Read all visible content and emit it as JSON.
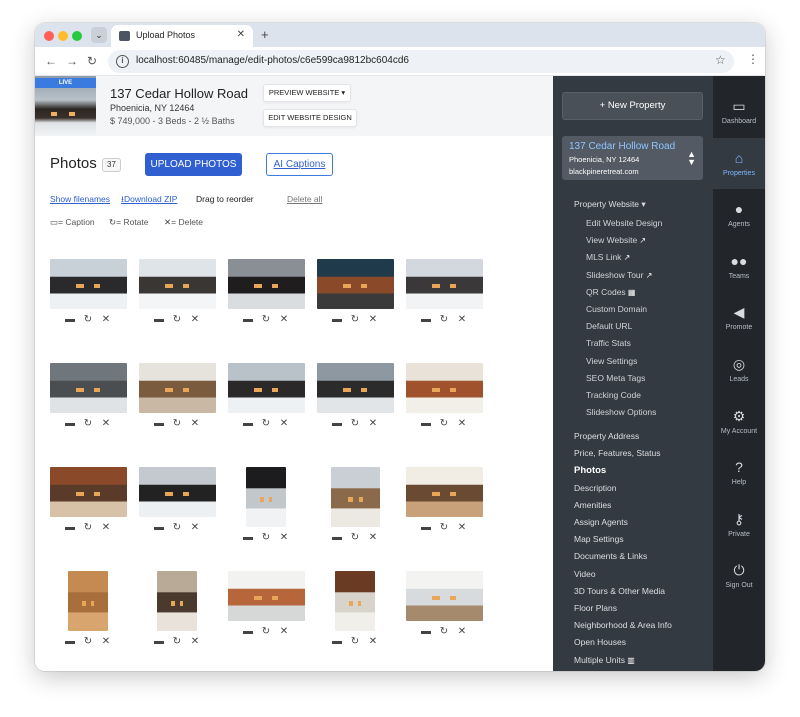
{
  "browser": {
    "tab_title": "Upload Photos",
    "url": "localhost:60485/manage/edit-photos/c6e599ca9812bc604cd6"
  },
  "property": {
    "badge": "LIVE",
    "title": "137 Cedar Hollow Road",
    "city": "Phoenicia, NY 12464",
    "price_line": "$ 749,000 - 3 Beds - 2 ½ Baths",
    "preview_label": "PREVIEW WEBSITE ▾",
    "edit_design_label": "EDIT WEBSITE DESIGN"
  },
  "photos_section": {
    "title": "Photos",
    "count": "37",
    "upload_label": "UPLOAD PHOTOS",
    "ai_label": "AI Captions",
    "show_filenames": "Show filenames",
    "download_zip": "Download ZIP",
    "drag_text": "Drag to reorder",
    "delete_all": "Delete all",
    "legend_caption": "= Caption",
    "legend_rotate": "= Rotate",
    "legend_delete": "= Delete"
  },
  "photos": [
    {
      "colors": [
        "#c8d0d8",
        "#2a2a2c",
        "#eef1f3"
      ]
    },
    {
      "colors": [
        "#dfe4e8",
        "#3a3634",
        "#f3f5f6"
      ]
    },
    {
      "colors": [
        "#8a8f96",
        "#1f1d1e",
        "#d9dde0"
      ]
    },
    {
      "colors": [
        "#1f3a4a",
        "#8a4a2a",
        "#3a3a3a"
      ]
    },
    {
      "colors": [
        "#d2d8dd",
        "#3a3838",
        "#f1f3f4"
      ]
    },
    {
      "colors": [
        "#6f767c",
        "#4a4e50",
        "#dfe3e6"
      ]
    },
    {
      "colors": [
        "#e6e2dc",
        "#7a5b3e",
        "#c9b9a4"
      ]
    },
    {
      "colors": [
        "#b9c1c9",
        "#2a2829",
        "#eef1f3"
      ]
    },
    {
      "colors": [
        "#8e98a1",
        "#2c2b2c",
        "#e1e5e8"
      ]
    },
    {
      "colors": [
        "#e8e2d8",
        "#a0522d",
        "#f2eee8"
      ]
    },
    {
      "colors": [
        "#8a4a2a",
        "#5a3b2a",
        "#d7c2a8"
      ]
    },
    {
      "colors": [
        "#c3c9ce",
        "#232223",
        "#ecf0f2"
      ]
    },
    {
      "colors": [
        "#1c1b1d",
        "#c2c7cc",
        "#f0f2f4"
      ]
    },
    {
      "colors": [
        "#c9cfd4",
        "#8a6a4a",
        "#ece8e2"
      ]
    },
    {
      "colors": [
        "#f1ece4",
        "#6b4a33",
        "#c8a07a"
      ]
    },
    {
      "colors": [
        "#c58a52",
        "#a86e3c",
        "#d9a56f"
      ]
    },
    {
      "colors": [
        "#b9aa98",
        "#4a3a2e",
        "#e8e2da"
      ]
    },
    {
      "colors": [
        "#f2f2f0",
        "#b7653a",
        "#d6d8d8"
      ]
    },
    {
      "colors": [
        "#6a3a22",
        "#d8d4cc",
        "#f1efea"
      ]
    },
    {
      "colors": [
        "#f3f3f2",
        "#d7dbdd",
        "#a58a6d"
      ]
    }
  ],
  "sidebar": {
    "new_property": "New Property",
    "card_title": "137 Cedar Hollow Road",
    "card_city": "Phoenicia, NY 12464",
    "card_domain": "blackpineretreat.com",
    "property_website": "Property Website ▾",
    "sub_items": [
      {
        "label": "Edit Website Design",
        "ext": ""
      },
      {
        "label": "View Website",
        "ext": "↗"
      },
      {
        "label": "MLS Link",
        "ext": "↗"
      },
      {
        "label": "Slideshow Tour",
        "ext": "↗"
      },
      {
        "label": "QR Codes",
        "ext": "▦"
      },
      {
        "label": "Custom Domain",
        "ext": ""
      },
      {
        "label": "Default URL",
        "ext": ""
      },
      {
        "label": "Traffic Stats",
        "ext": ""
      },
      {
        "label": "View Settings",
        "ext": ""
      },
      {
        "label": "SEO Meta Tags",
        "ext": ""
      },
      {
        "label": "Tracking Code",
        "ext": ""
      },
      {
        "label": "Slideshow Options",
        "ext": ""
      }
    ],
    "items": [
      {
        "label": "Property Address",
        "active": false,
        "ext": ""
      },
      {
        "label": "Price, Features, Status",
        "active": false,
        "ext": ""
      },
      {
        "label": "Photos",
        "active": true,
        "ext": ""
      },
      {
        "label": "Description",
        "active": false,
        "ext": ""
      },
      {
        "label": "Amenities",
        "active": false,
        "ext": ""
      },
      {
        "label": "Assign Agents",
        "active": false,
        "ext": ""
      },
      {
        "label": "Map Settings",
        "active": false,
        "ext": ""
      },
      {
        "label": "Documents & Links",
        "active": false,
        "ext": ""
      },
      {
        "label": "Video",
        "active": false,
        "ext": ""
      },
      {
        "label": "3D Tours & Other Media",
        "active": false,
        "ext": ""
      },
      {
        "label": "Floor Plans",
        "active": false,
        "ext": ""
      },
      {
        "label": "Neighborhood & Area Info",
        "active": false,
        "ext": ""
      },
      {
        "label": "Open Houses",
        "active": false,
        "ext": ""
      },
      {
        "label": "Multiple Units",
        "active": false,
        "ext": "▥"
      }
    ]
  },
  "rail": [
    {
      "label": "Dashboard",
      "icon": "dashboard-icon",
      "glyph": "▭",
      "active": false
    },
    {
      "label": "Properties",
      "icon": "properties-icon",
      "glyph": "⌂",
      "active": true
    },
    {
      "label": "Agents",
      "icon": "agents-icon",
      "glyph": "●",
      "active": false
    },
    {
      "label": "Teams",
      "icon": "teams-icon",
      "glyph": "●●",
      "active": false
    },
    {
      "label": "Promote",
      "icon": "megaphone-icon",
      "glyph": "◀",
      "active": false
    },
    {
      "label": "Leads",
      "icon": "target-icon",
      "glyph": "◎",
      "active": false
    },
    {
      "label": "My Account",
      "icon": "gear-icon",
      "glyph": "⚙",
      "active": false
    },
    {
      "label": "Help",
      "icon": "help-icon",
      "glyph": "?",
      "active": false
    },
    {
      "label": "Private",
      "icon": "key-icon",
      "glyph": "⚷",
      "active": false
    },
    {
      "label": "Sign Out",
      "icon": "power-icon",
      "glyph": "⏻",
      "active": false
    }
  ]
}
